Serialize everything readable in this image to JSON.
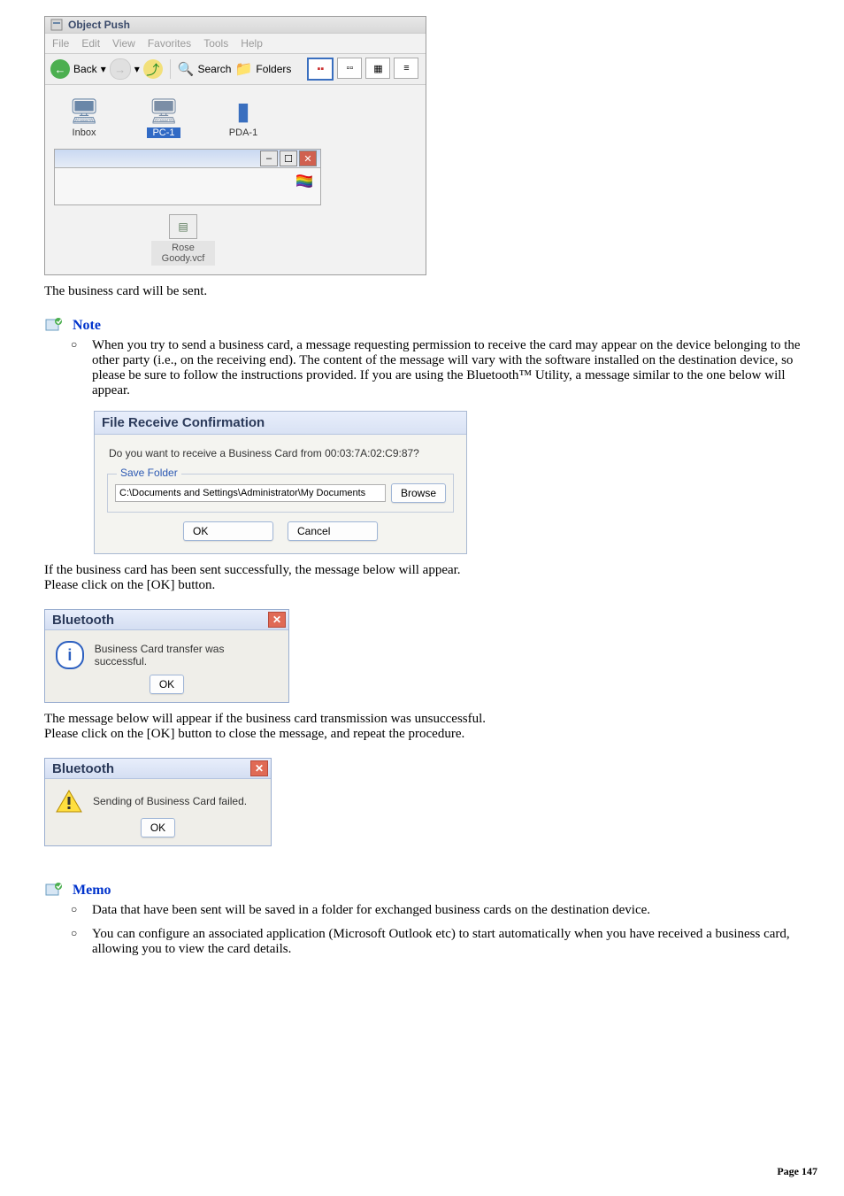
{
  "objectPush": {
    "windowTitle": "Object Push",
    "menu": [
      "File",
      "Edit",
      "View",
      "Favorites",
      "Tools",
      "Help"
    ],
    "toolbar": {
      "backLabel": "Back",
      "dropdownGlyph": "▾",
      "searchLabel": "Search",
      "foldersLabel": "Folders"
    },
    "items": {
      "inbox": "Inbox",
      "pc1": "PC-1",
      "pda1": "PDA-1"
    },
    "vcf": {
      "name": "Rose Goody.vcf"
    }
  },
  "afterWindow": "The business card will be sent.",
  "noteSection": {
    "heading": "Note",
    "bullet1": "When you try to send a business card, a message requesting permission to receive the card may appear on the device belonging to the other party (i.e., on the receiving end). The content of the message will vary with the software installed on the destination device, so please be sure to follow the instructions provided. If you are using the Bluetooth™ Utility, a message similar to the one below will appear."
  },
  "receiveDialog": {
    "title": "File Receive Confirmation",
    "question": "Do you want to receive a Business Card from 00:03:7A:02:C9:87?",
    "legend": "Save Folder",
    "path": "C:\\Documents and Settings\\Administrator\\My Documents",
    "browse": "Browse",
    "ok": "OK",
    "cancel": "Cancel"
  },
  "afterReceive1": "If the business card has been sent successfully, the message below will appear.",
  "afterReceive2": "Please click on the [OK] button.",
  "successDialog": {
    "title": "Bluetooth",
    "message": "Business Card transfer was successful.",
    "ok": "OK"
  },
  "afterSuccess1": "The message below will appear if the business card transmission was unsuccessful.",
  "afterSuccess2": "Please click on the [OK] button to close the message, and repeat the procedure.",
  "failDialog": {
    "title": "Bluetooth",
    "message": "Sending of Business Card failed.",
    "ok": "OK"
  },
  "memoSection": {
    "heading": "Memo",
    "bullet1": "Data that have been sent will be saved in a folder for exchanged business cards on the destination device.",
    "bullet2": "You can configure an associated application (Microsoft Outlook etc) to start automatically when you have received a business card, allowing you to view the card details."
  },
  "footer": {
    "label": "Page ",
    "number": "147"
  }
}
